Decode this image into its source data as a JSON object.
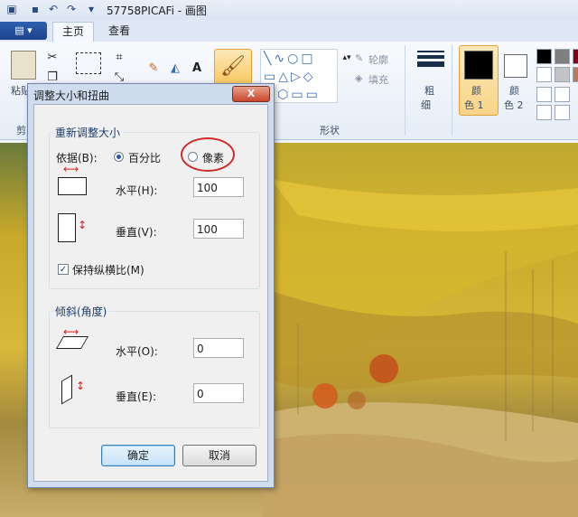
{
  "window": {
    "title": "57758PICAFi - 画图"
  },
  "ribbon": {
    "tabs": [
      "主页",
      "查看"
    ],
    "paste_label": "粘贴",
    "clipboard_group": "剪",
    "shapes_group": "形状",
    "outline_label": "轮廓",
    "fill_label": "填充",
    "size_label_1": "粗",
    "size_label_2": "细",
    "color1_label_1": "颜",
    "color1_label_2": "色 1",
    "color2_label_1": "颜",
    "color2_label_2": "色 2",
    "palette": [
      "#000000",
      "#7f7f7f",
      "#880015",
      "#ffffff",
      "#c3c3c3",
      "#b97a57"
    ]
  },
  "dialog": {
    "title": "调整大小和扭曲",
    "close": "X",
    "resize": {
      "legend": "重新调整大小",
      "by_label": "依据(B):",
      "option_percent": "百分比",
      "option_pixels": "像素",
      "horizontal_label": "水平(H):",
      "horizontal_value": "100",
      "vertical_label": "垂直(V):",
      "vertical_value": "100",
      "keep_ratio_label": "保持纵横比(M)"
    },
    "skew": {
      "legend": "倾斜(角度)",
      "horizontal_label": "水平(O):",
      "horizontal_value": "0",
      "vertical_label": "垂直(E):",
      "vertical_value": "0"
    },
    "ok": "确定",
    "cancel": "取消"
  },
  "colors": {
    "accent": "#1c448c",
    "highlight_circle": "#d22a2a"
  }
}
